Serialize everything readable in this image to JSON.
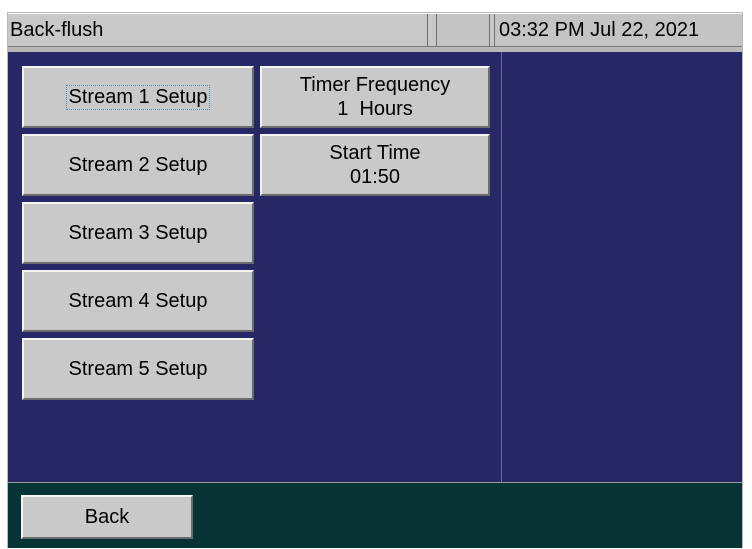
{
  "header": {
    "title": "Back-flush",
    "datetime": "03:32 PM Jul 22, 2021"
  },
  "streams": [
    {
      "label": "Stream 1 Setup"
    },
    {
      "label": "Stream 2 Setup"
    },
    {
      "label": "Stream 3 Setup"
    },
    {
      "label": "Stream 4 Setup"
    },
    {
      "label": "Stream 5 Setup"
    }
  ],
  "settings": {
    "timer_frequency": {
      "label": "Timer Frequency",
      "value": "1  Hours"
    },
    "start_time": {
      "label": "Start Time",
      "value": "01:50"
    }
  },
  "footer": {
    "back_label": "Back"
  },
  "colors": {
    "main_panel": "#272766",
    "footer_panel": "#063333",
    "button_face": "#c9c9c9",
    "header_bar": "#c8c8c8"
  }
}
